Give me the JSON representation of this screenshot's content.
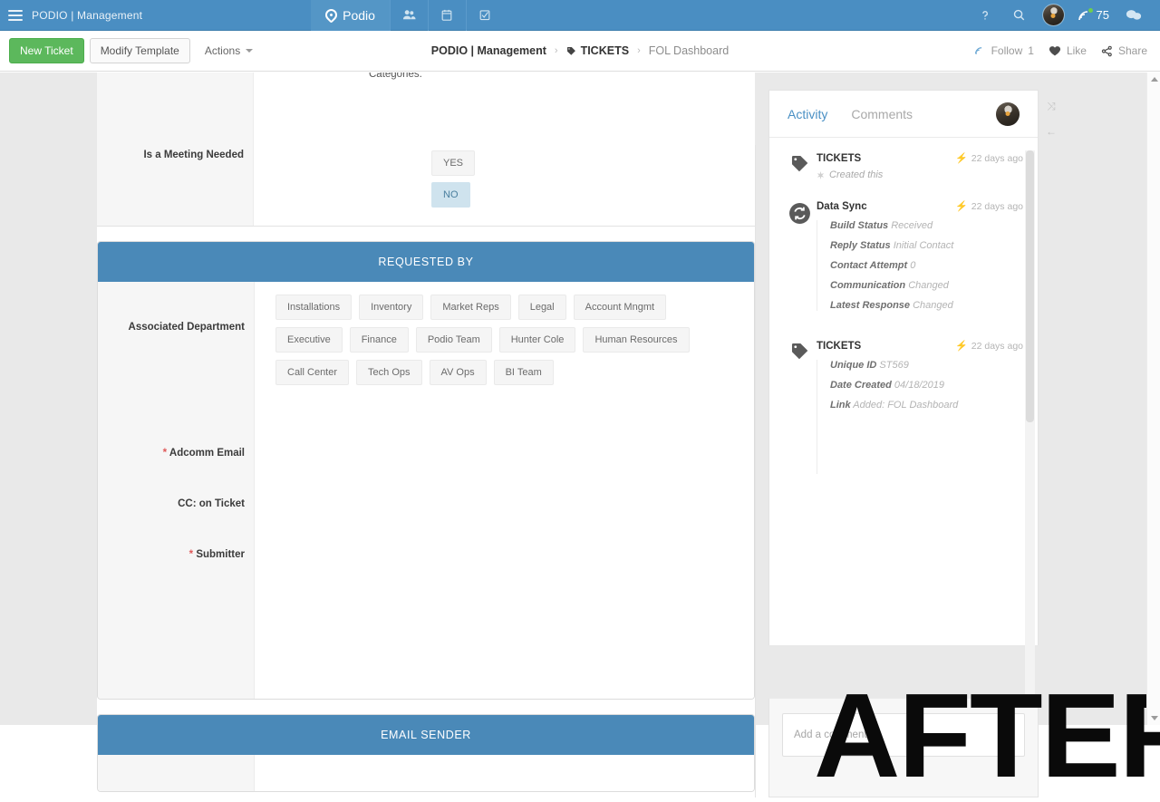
{
  "topbar": {
    "menu_icon": "hamburger-icon",
    "org_title": "PODIO | Management",
    "brand": "Podio",
    "nav_icons": [
      "contacts-icon",
      "calendar-icon",
      "tasks-icon"
    ],
    "help_icon": "question-mark-icon",
    "search_icon": "search-icon",
    "avatar": "user-avatar",
    "activity_icon": "signal-icon",
    "notification_count": "75",
    "chat_icon": "chat-bubbles-icon"
  },
  "toolbar": {
    "new_ticket": "New Ticket",
    "modify_template": "Modify Template",
    "actions": "Actions",
    "breadcrumb": {
      "workspace": "PODIO | Management",
      "separator": "›",
      "app": "TICKETS",
      "item": "FOL Dashboard"
    },
    "follow": "Follow",
    "follow_count": "1",
    "like": "Like",
    "share": "Share"
  },
  "form": {
    "cut_off_label": "Categories:",
    "meeting": {
      "label": "Is a Meeting Needed",
      "options": [
        "YES",
        "NO"
      ],
      "selected": "NO"
    },
    "requested_by": {
      "header": "REQUESTED BY",
      "department_label": "Associated Department",
      "departments": [
        "Installations",
        "Inventory",
        "Market Reps",
        "Legal",
        "Account Mngmt",
        "Executive",
        "Finance",
        "Podio Team",
        "Hunter Cole",
        "Human Resources",
        "Call Center",
        "Tech Ops",
        "AV Ops",
        "BI Team"
      ],
      "fields": [
        {
          "label": "Adcomm Email",
          "required": true,
          "value": ""
        },
        {
          "label": "CC: on Ticket",
          "required": false,
          "value": ""
        },
        {
          "label": "Submitter",
          "required": true,
          "value": ""
        }
      ]
    },
    "email_sender": {
      "header": "EMAIL SENDER"
    }
  },
  "panel": {
    "tabs": [
      {
        "label": "Activity",
        "active": true
      },
      {
        "label": "Comments",
        "active": false
      }
    ],
    "avatar": "user-avatar",
    "close_icon": "collapse-icon",
    "back_icon": "arrow-left-icon",
    "activities": [
      {
        "icon": "tag-icon",
        "title": "TICKETS",
        "time": "22 days ago",
        "subtitle": "Created this",
        "entries": []
      },
      {
        "icon": "sync-icon",
        "title": "Data Sync",
        "time": "22 days ago",
        "subtitle": "",
        "entries": [
          {
            "key": "Build Status",
            "value": "Received"
          },
          {
            "key": "Reply Status",
            "value": "Initial Contact"
          },
          {
            "key": "Contact Attempt",
            "value": "0"
          },
          {
            "key": "Communication",
            "value": "Changed"
          },
          {
            "key": "Latest Response",
            "value": "Changed"
          }
        ]
      },
      {
        "icon": "tag-icon",
        "title": "TICKETS",
        "time": "22 days ago",
        "subtitle": "",
        "entries": [
          {
            "key": "Unique ID",
            "value": "ST569"
          },
          {
            "key": "Date Created",
            "value": "04/18/2019"
          },
          {
            "key": "Link",
            "value": "Added: FOL Dashboard"
          }
        ]
      }
    ],
    "comment_placeholder": "Add a comment"
  },
  "watermark": {
    "text": "AFTER"
  },
  "colors": {
    "topbar_blue": "#4a8ec2",
    "section_blue": "#4a89b8",
    "green_button": "#5cb85c",
    "chip_selected": "#cfe3ee",
    "required_red": "#e05a5a",
    "tab_active": "#4a90c4"
  }
}
